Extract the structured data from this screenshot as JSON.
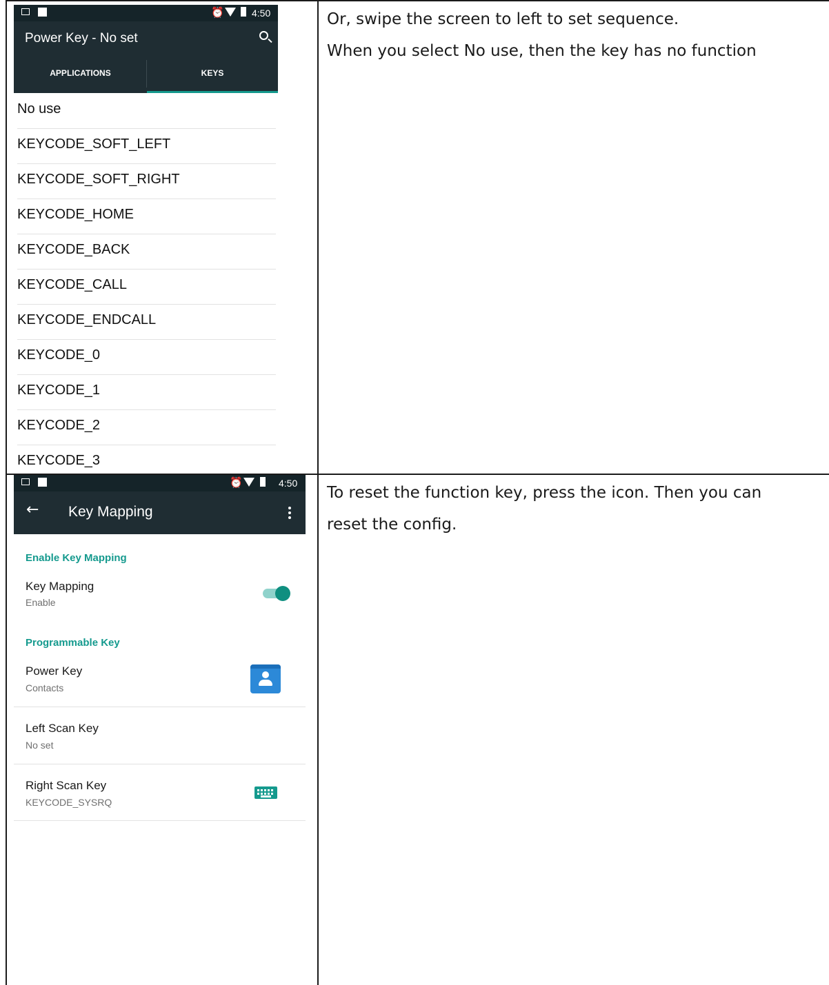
{
  "top_phone": {
    "status": {
      "time": "4:50"
    },
    "title": "Power Key - No set",
    "tabs": [
      "APPLICATIONS",
      "KEYS"
    ],
    "keys": [
      "No use",
      "KEYCODE_SOFT_LEFT",
      "KEYCODE_SOFT_RIGHT",
      "KEYCODE_HOME",
      "KEYCODE_BACK",
      "KEYCODE_CALL",
      "KEYCODE_ENDCALL",
      "KEYCODE_0",
      "KEYCODE_1",
      "KEYCODE_2",
      "KEYCODE_3"
    ]
  },
  "top_note": {
    "line1": "Or, swipe the screen to left to set sequence.",
    "line2": "When you select No use, then the key has no function"
  },
  "bottom_phone": {
    "status": {
      "time": "4:50"
    },
    "title": "Key Mapping",
    "sections": {
      "enable": "Enable Key Mapping",
      "programmable": "Programmable Key"
    },
    "key_mapping": {
      "title": "Key Mapping",
      "summary": "Enable",
      "on": true
    },
    "power_key": {
      "title": "Power Key",
      "summary": "Contacts",
      "icon": "contacts-icon"
    },
    "left_scan_key": {
      "title": "Left Scan Key",
      "summary": "No set"
    },
    "right_scan_key": {
      "title": "Right Scan Key",
      "summary": "KEYCODE_SYSRQ",
      "icon": "keyboard-icon"
    },
    "accent_color": "#159a8e"
  },
  "bottom_note": {
    "line1": "To reset the function key, press the icon. Then you can",
    "line2": "reset the config."
  }
}
